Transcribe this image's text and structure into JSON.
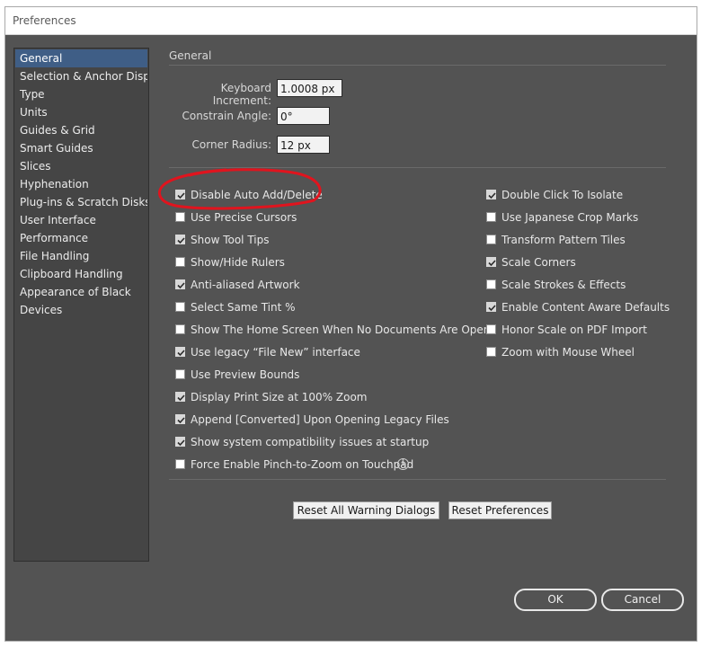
{
  "window": {
    "title": "Preferences"
  },
  "sidebar": {
    "items": [
      {
        "label": "General",
        "selected": true
      },
      {
        "label": "Selection & Anchor Display"
      },
      {
        "label": "Type"
      },
      {
        "label": "Units"
      },
      {
        "label": "Guides & Grid"
      },
      {
        "label": "Smart Guides"
      },
      {
        "label": "Slices"
      },
      {
        "label": "Hyphenation"
      },
      {
        "label": "Plug-ins & Scratch Disks"
      },
      {
        "label": "User Interface"
      },
      {
        "label": "Performance"
      },
      {
        "label": "File Handling"
      },
      {
        "label": "Clipboard Handling"
      },
      {
        "label": "Appearance of Black"
      },
      {
        "label": "Devices"
      }
    ]
  },
  "general": {
    "section_title": "General",
    "keyboard_increment": {
      "label": "Keyboard Increment:",
      "value": "1.0008 px"
    },
    "constrain_angle": {
      "label": "Constrain Angle:",
      "value": "0°"
    },
    "corner_radius": {
      "label": "Corner Radius:",
      "value": "12 px"
    }
  },
  "options_left": [
    {
      "label": "Disable Auto Add/Delete",
      "checked": true
    },
    {
      "label": "Use Precise Cursors",
      "checked": false
    },
    {
      "label": "Show Tool Tips",
      "checked": true
    },
    {
      "label": "Show/Hide Rulers",
      "checked": false
    },
    {
      "label": "Anti-aliased Artwork",
      "checked": true
    },
    {
      "label": "Select Same Tint %",
      "checked": false
    },
    {
      "label": "Show The Home Screen When No Documents Are Open",
      "checked": false
    },
    {
      "label": "Use legacy “File New” interface",
      "checked": true
    },
    {
      "label": "Use Preview Bounds",
      "checked": false
    },
    {
      "label": "Display Print Size at 100% Zoom",
      "checked": true
    },
    {
      "label": "Append [Converted] Upon Opening Legacy Files",
      "checked": true
    },
    {
      "label": "Show system compatibility issues at startup",
      "checked": true
    },
    {
      "label": "Force Enable Pinch-to-Zoom on Touchpad",
      "checked": false
    }
  ],
  "options_right": [
    {
      "label": "Double Click To Isolate",
      "checked": true
    },
    {
      "label": "Use Japanese Crop Marks",
      "checked": false
    },
    {
      "label": "Transform Pattern Tiles",
      "checked": false
    },
    {
      "label": "Scale Corners",
      "checked": true
    },
    {
      "label": "Scale Strokes & Effects",
      "checked": false
    },
    {
      "label": "Enable Content Aware Defaults",
      "checked": true
    },
    {
      "label": "Honor Scale on PDF Import",
      "checked": false
    },
    {
      "label": "Zoom with Mouse Wheel",
      "checked": false
    }
  ],
  "info_icon": {
    "glyph": "i",
    "icon": "info-icon"
  },
  "buttons": {
    "reset_warnings": "Reset All Warning Dialogs",
    "reset_preferences": "Reset Preferences",
    "ok": "OK",
    "cancel": "Cancel"
  },
  "colors": {
    "panel_bg": "#535353",
    "sidebar_bg": "#454545",
    "selection": "#3f5e86",
    "annotation": "#e0141e"
  }
}
